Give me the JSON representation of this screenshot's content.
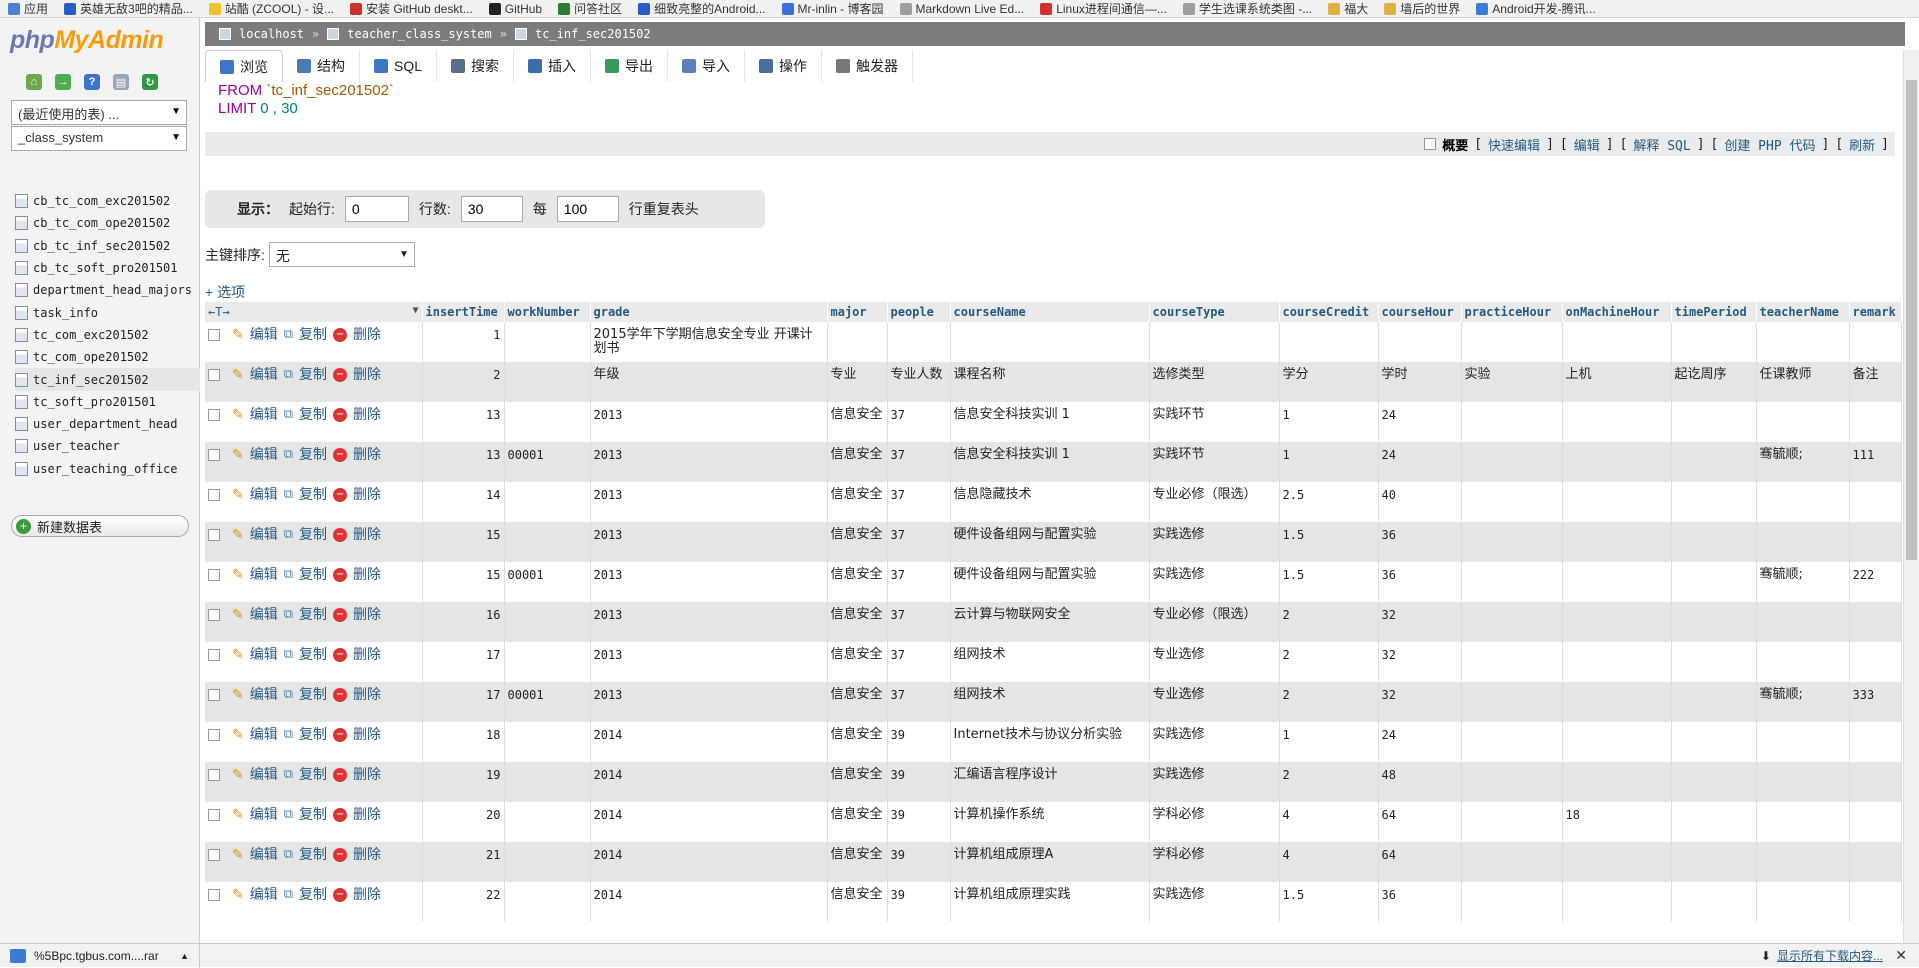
{
  "bookmarks": [
    {
      "label": "应用",
      "color": "#4a7fd3"
    },
    {
      "label": "英雄无敌3吧的精品...",
      "color": "#2a5cc7"
    },
    {
      "label": "站酷 (ZCOOL) - 设...",
      "color": "#f2c22b"
    },
    {
      "label": "安装 GitHub deskt...",
      "color": "#d32f2f"
    },
    {
      "label": "GitHub",
      "color": "#222222"
    },
    {
      "label": "问答社区",
      "color": "#2e7d32"
    },
    {
      "label": "细致亮整的Android...",
      "color": "#2a5cc7"
    },
    {
      "label": "Mr-inlin - 博客园",
      "color": "#3b6fd6"
    },
    {
      "label": "Markdown Live Ed...",
      "color": "#9e9e9e"
    },
    {
      "label": "Linux进程间通信—...",
      "color": "#d32f2f"
    },
    {
      "label": "学生选课系统类图 -...",
      "color": "#9e9e9e"
    },
    {
      "label": "福大",
      "color": "#e0b040"
    },
    {
      "label": "墙后的世界",
      "color": "#e0b040"
    },
    {
      "label": "Android开发-腾讯...",
      "color": "#3b7dd8"
    }
  ],
  "left": {
    "logo_php": "php",
    "logo_myadmin": "MyAdmin",
    "recent_select": "(最近使用的表) ...",
    "db_select": "_class_system",
    "tables": [
      "cb_tc_com_exc201502",
      "cb_tc_com_ope201502",
      "cb_tc_inf_sec201502",
      "cb_tc_soft_pro201501",
      "department_head_majors",
      "task_info",
      "tc_com_exc201502",
      "tc_com_ope201502",
      "tc_inf_sec201502",
      "tc_soft_pro201501",
      "user_department_head",
      "user_teacher",
      "user_teaching_office"
    ],
    "active_table_index": 8,
    "new_table": "新建数据表"
  },
  "breadcrumb": {
    "server": "localhost",
    "database": "teacher_class_system",
    "table": "tc_inf_sec201502"
  },
  "tabs": [
    "浏览",
    "结构",
    "SQL",
    "搜索",
    "插入",
    "导出",
    "导入",
    "操作",
    "触发器"
  ],
  "sql": {
    "from_kw": "FROM",
    "table": "`tc_inf_sec201502`",
    "limit_kw": "LIMIT",
    "limit_val": "0 , 30"
  },
  "sql_actions": {
    "profile": "概要",
    "inline_edit": "快速编辑",
    "edit": "编辑",
    "explain": "解释 SQL",
    "php_code": "创建 PHP 代码",
    "refresh": "刷新"
  },
  "nav": {
    "show": "显示：",
    "start_label": "起始行:",
    "start_val": "0",
    "rows_label": "行数:",
    "rows_val": "30",
    "per_label": "每",
    "per_val": "100",
    "repeat_label": "行重复表头"
  },
  "sort": {
    "label": "主键排序:",
    "value": "无"
  },
  "options_link": "+ 选项",
  "columns": [
    "insertTime",
    "workNumber",
    "grade",
    "major",
    "people",
    "courseName",
    "courseType",
    "courseCredit",
    "courseHour",
    "practiceHour",
    "onMachineHour",
    "timePeriod",
    "teacherName",
    "remark"
  ],
  "row_actions": {
    "edit": "编辑",
    "copy": "复制",
    "delete": "删除"
  },
  "rows": [
    [
      "1",
      "",
      "2015学年下学期信息安全专业  开课计划书",
      "",
      "",
      "",
      "",
      "",
      "",
      "",
      "",
      "",
      "",
      ""
    ],
    [
      "2",
      "",
      "年级",
      "专业",
      "专业人数",
      "课程名称",
      "选修类型",
      "学分",
      "学时",
      "实验",
      "上机",
      "起讫周序",
      "任课教师",
      "备注"
    ],
    [
      "13",
      "",
      "2013",
      "信息安全",
      "37",
      "  信息安全科技实训 1",
      "  实践环节",
      "1",
      "24",
      "",
      "",
      "",
      "",
      ""
    ],
    [
      "13",
      "00001",
      "2013",
      "信息安全",
      "37",
      "  信息安全科技实训 1",
      "  实践环节",
      "1",
      "24",
      "",
      "",
      "",
      "骞毓顺;",
      "111"
    ],
    [
      "14",
      "",
      "2013",
      "信息安全",
      "37",
      "  信息隐藏技术",
      "  专业必修（限选）",
      "2.5",
      "40",
      "",
      "",
      "",
      "",
      ""
    ],
    [
      "15",
      "",
      "2013",
      "信息安全",
      "37",
      "  硬件设备组网与配置实验",
      "  实践选修",
      "1.5",
      "36",
      "",
      "",
      "",
      "",
      ""
    ],
    [
      "15",
      "00001",
      "2013",
      "信息安全",
      "37",
      "  硬件设备组网与配置实验",
      "  实践选修",
      "1.5",
      "36",
      "",
      "",
      "",
      "骞毓顺;",
      "222"
    ],
    [
      "16",
      "",
      "2013",
      "信息安全",
      "37",
      "  云计算与物联网安全",
      "  专业必修（限选）",
      "2",
      "32",
      "",
      "",
      "",
      "",
      ""
    ],
    [
      "17",
      "",
      "2013",
      "信息安全",
      "37",
      "  组网技术",
      "  专业选修",
      "2",
      "32",
      "",
      "",
      "",
      "",
      ""
    ],
    [
      "17",
      "00001",
      "2013",
      "信息安全",
      "37",
      "  组网技术",
      "  专业选修",
      "2",
      "32",
      "",
      "",
      "",
      "骞毓顺;",
      "333"
    ],
    [
      "18",
      "",
      "2014",
      "信息安全",
      "39",
      "  Internet技术与协议分析实验",
      "  实践选修",
      "1",
      "24",
      "",
      "",
      "",
      "",
      ""
    ],
    [
      "19",
      "",
      "2014",
      "信息安全",
      "39",
      "  汇编语言程序设计",
      "  实践选修",
      "2",
      "48",
      "",
      "",
      "",
      "",
      ""
    ],
    [
      "20",
      "",
      "2014",
      "信息安全",
      "39",
      "  计算机操作系统",
      "  学科必修",
      "4",
      "64",
      "",
      "18",
      "",
      "",
      ""
    ],
    [
      "21",
      "",
      "2014",
      "信息安全",
      "39",
      "  计算机组成原理A",
      "  学科必修",
      "4",
      "64",
      "",
      "",
      "",
      "",
      ""
    ],
    [
      "22",
      "",
      "2014",
      "信息安全",
      "39",
      "  计算机组成原理实践",
      "  实践选修",
      "1.5",
      "36",
      "",
      "",
      "",
      "",
      ""
    ]
  ],
  "download": {
    "file": "%5Bpc.tgbus.com....rar",
    "show_all": "显示所有下载内容..."
  }
}
